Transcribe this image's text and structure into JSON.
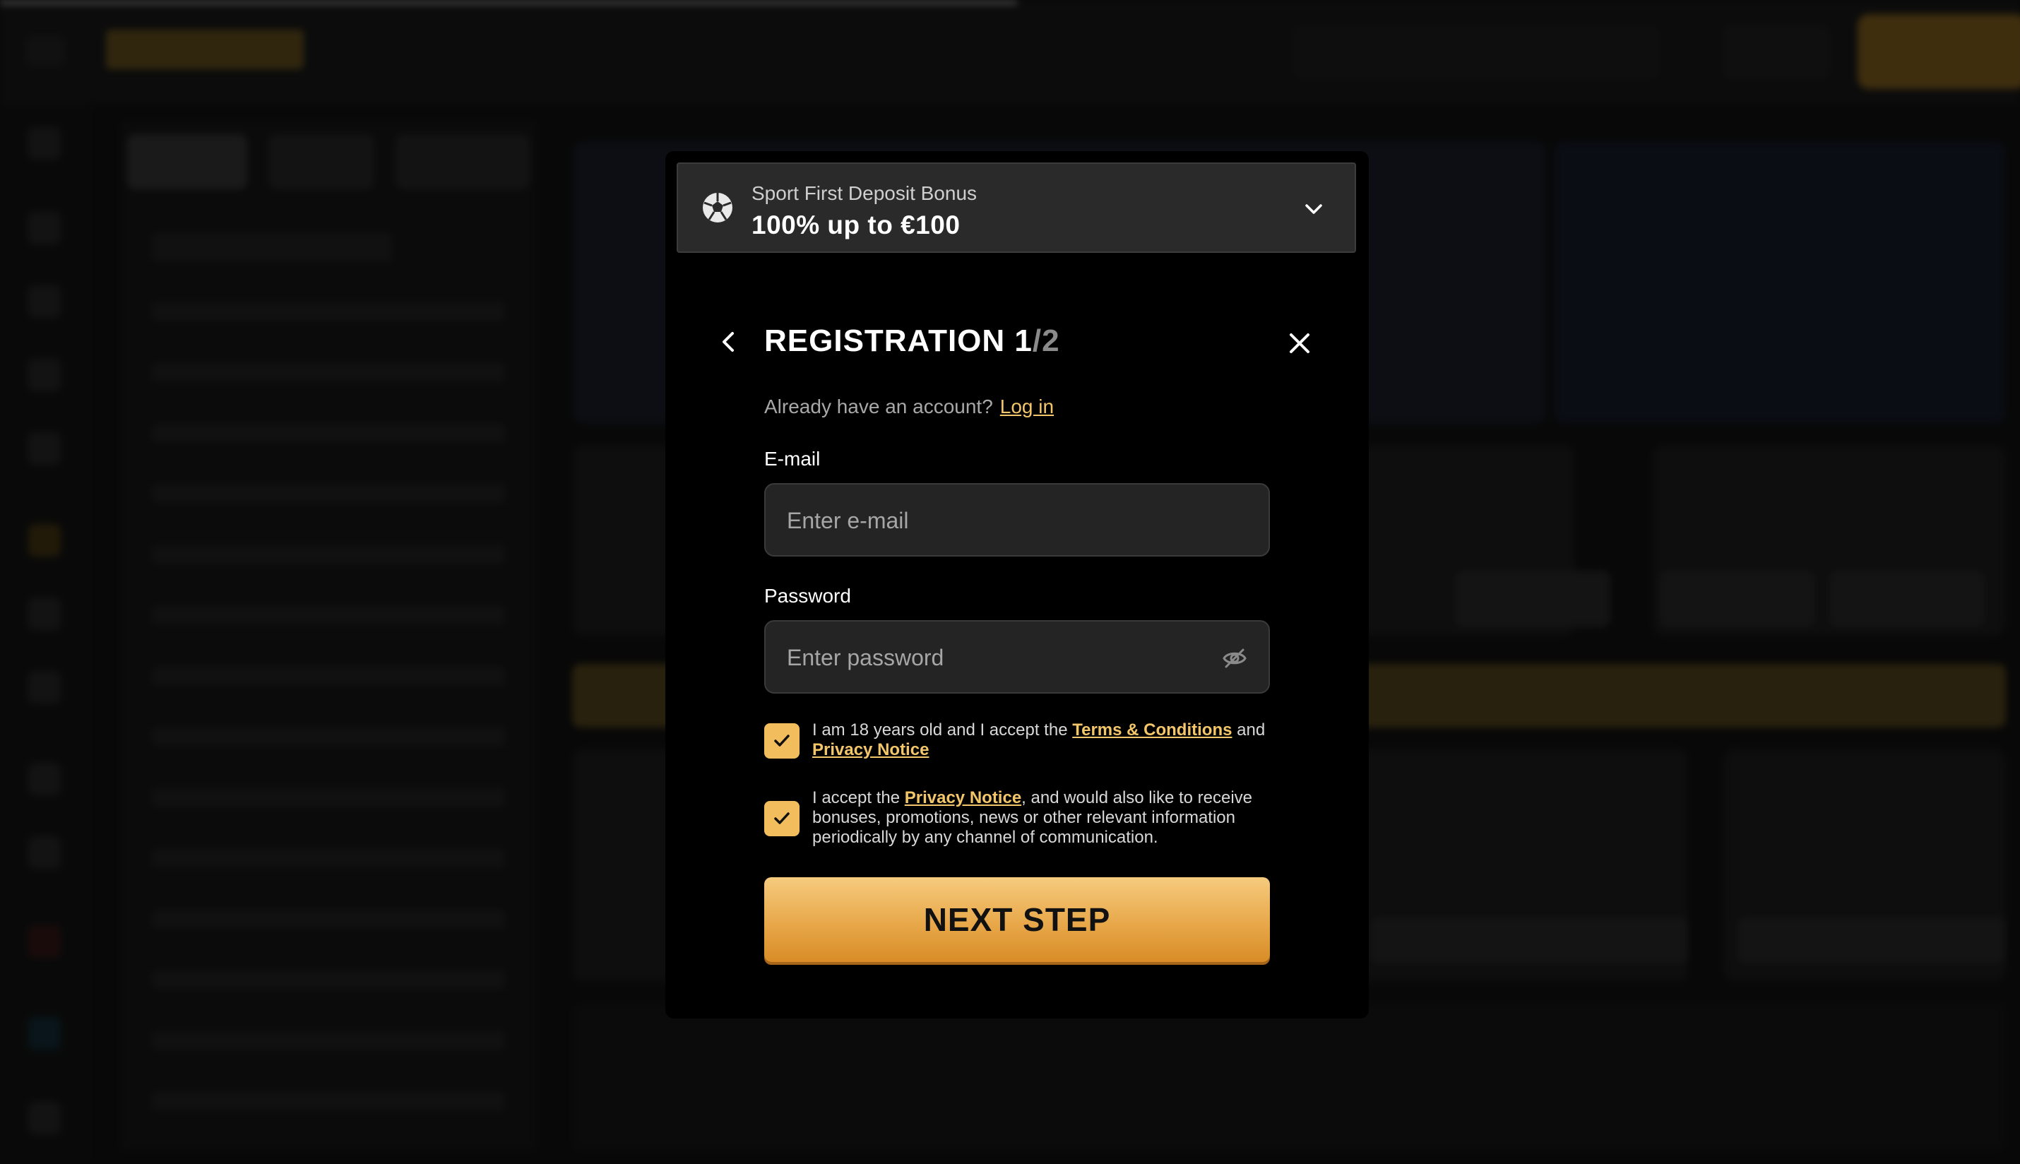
{
  "bonus": {
    "subtitle": "Sport First Deposit Bonus",
    "offer": "100% up to €100"
  },
  "registration": {
    "title_main": "REGISTRATION 1",
    "title_suffix": "/2",
    "already_account": "Already have an account?",
    "login_link": "Log in",
    "email_label": "E-mail",
    "email_placeholder": "Enter e-mail",
    "password_label": "Password",
    "password_placeholder": "Enter password",
    "consent_age": {
      "text_before": "I am 18 years old and I accept the ",
      "terms_link": "Terms & Conditions",
      "text_and": " and ",
      "privacy_link": "Privacy Notice",
      "checked": true
    },
    "consent_marketing": {
      "text_before": "I accept the ",
      "privacy_link": "Privacy Notice",
      "text_after": ", and would also like to receive bonuses, promotions, news or other relevant information periodically by any channel of communication.",
      "checked": true
    },
    "next_button": "NEXT STEP"
  },
  "colors": {
    "accent": "#f2bd5c",
    "link": "#f4c66a",
    "modal_bg": "#000000"
  },
  "icons": [
    "soccer-ball-icon",
    "chevron-down-icon",
    "back-arrow-icon",
    "close-icon",
    "eye-off-icon",
    "check-icon"
  ]
}
